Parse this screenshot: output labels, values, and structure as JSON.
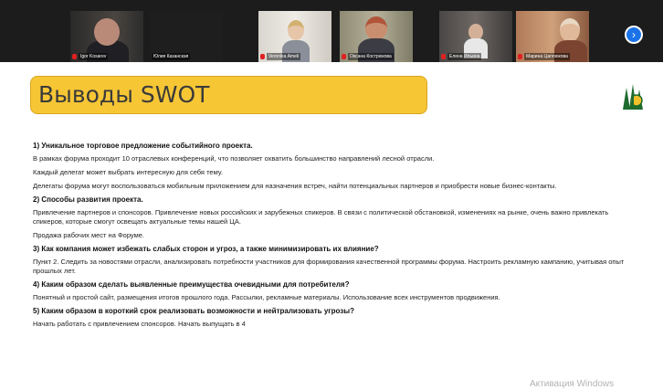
{
  "participants": [
    {
      "name": "Igor Kosarev"
    },
    {
      "name": "Юлия Казанская"
    },
    {
      "name": "Veronika Ameli"
    },
    {
      "name": "Оксана Кострюкова"
    },
    {
      "name": "Елена Ильина"
    },
    {
      "name": "Марина Цаплюкова"
    }
  ],
  "slide": {
    "title": "Выводы SWOT",
    "sections": [
      {
        "heading": "1)  Уникальное торговое предложение событийного проекта.",
        "paragraphs": [
          "В рамках форума проходит 10 отраслевых конференций, что позволяет охватить большинство направлений лесной отрасли.",
          "Каждый делегат может выбрать интересную для себя тему.",
          "Делегаты форума могут воспользоваться мобильным приложением для назначения встреч, найти потенциальных партнеров и приобрести новые бизнес-контакты."
        ]
      },
      {
        "heading": "2) Способы развития проекта.",
        "paragraphs": [
          "Привлечение партнеров и спонсоров. Привлечение новых российских и зарубежных спикеров. В связи с политической обстановкой, изменениях на рынке, очень важно привлекать спикеров, которые смогут освещать актуальные темы нашей ЦА.",
          "Продажа рабочих мест на Форуме."
        ]
      },
      {
        "heading": "3) Как компания может избежать слабых сторон и угроз, а также минимизировать их влияние?",
        "paragraphs": [
          "Пункт 2. Следить за новостями отрасли, анализировать потребности участников для формирования качественной программы форума. Настроить рекламную кампанию, учитывая опыт прошлых лет."
        ]
      },
      {
        "heading": "4) Каким образом сделать выявленные преимущества очевидными для потребителя?",
        "paragraphs": [
          "Понятный и простой сайт, размещения итогов прошлого года. Рассылки, рекламные материалы. Использование всех инструментов продвижения."
        ]
      },
      {
        "heading": "5) Каким образом в короткий срок реализовать возможности и нейтрализовать угрозы?",
        "paragraphs": [
          "Начать работать с привлечением спонсоров. Начать выпущать в 4"
        ]
      }
    ]
  },
  "watermark": "Активация Windows",
  "colors": {
    "title_bg": "#f6c635",
    "strip_bg": "#1c1c1c",
    "next_button": "#1a73e8"
  }
}
